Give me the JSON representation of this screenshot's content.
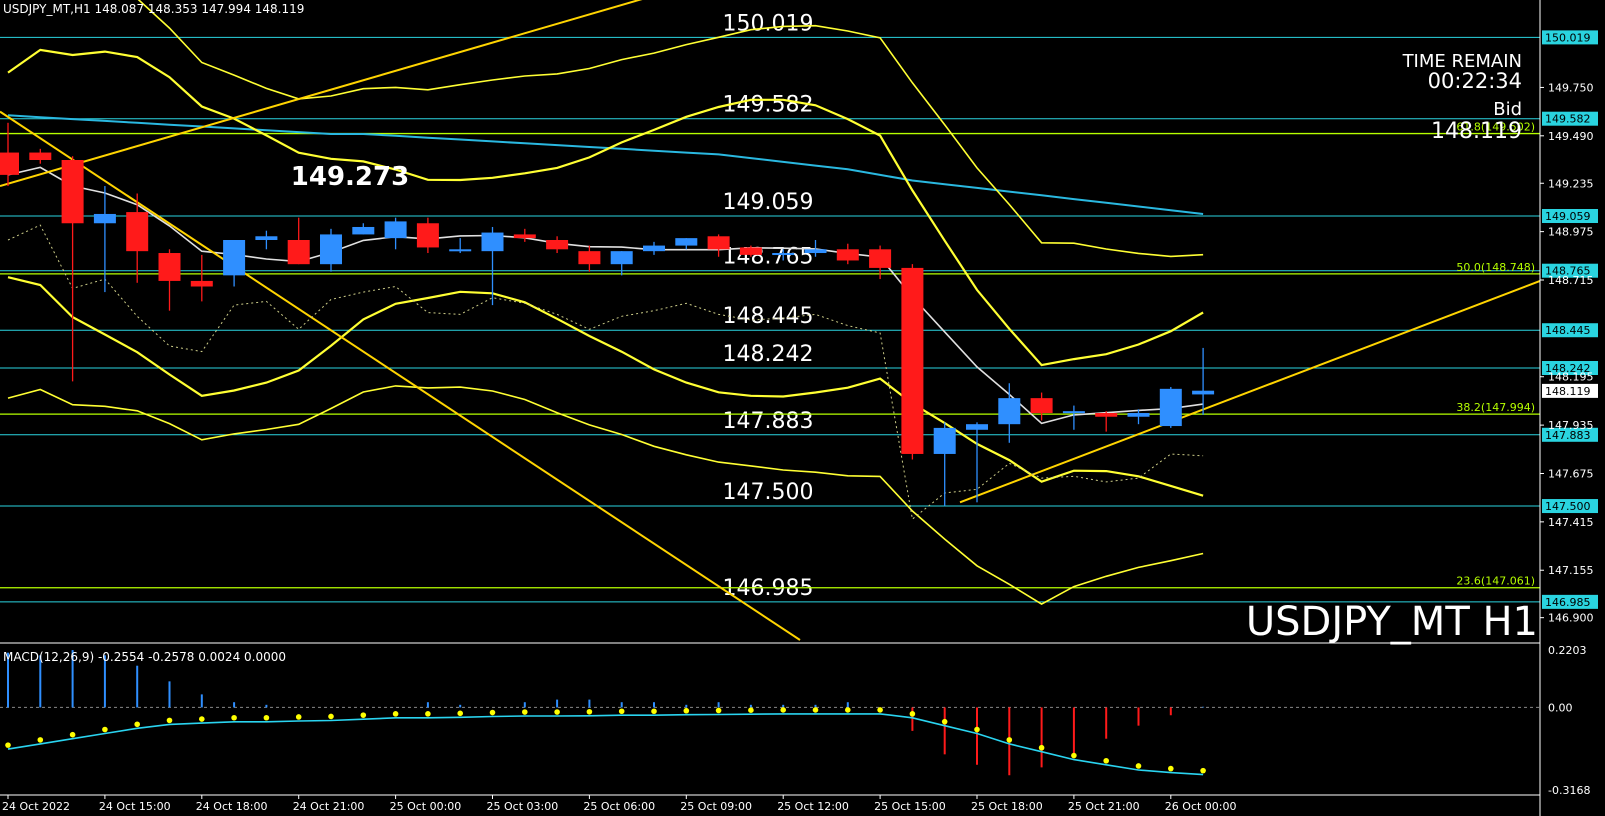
{
  "header": {
    "symbol_line": "USDJPY_MT,H1  148.087 148.353 147.994 148.119"
  },
  "overlay": {
    "time_remain_label": "TIME REMAIN",
    "time_remain_value": "00:22:34",
    "bid_label": "Bid",
    "bid_value": "148.119",
    "watermark": "USDJPY_MT H1"
  },
  "colors": {
    "bg": "#000000",
    "level_line": "#2ad4e0",
    "fib_line": "#b6ff00",
    "bull": "#2f8fff",
    "bear": "#ff1a1a",
    "band": "#ffff33",
    "trend": "#ffd400",
    "ma_white": "#e0e0e0",
    "ma_cyan": "#2ab8e0",
    "macd_signal": "#ffff00",
    "macd_main": "#2ad4f0"
  },
  "chart_data": {
    "type": "candlestick",
    "price_range": [
      146.78,
      150.22
    ],
    "time_axis": [
      "24 Oct 2022",
      "24 Oct 15:00",
      "24 Oct 18:00",
      "24 Oct 21:00",
      "25 Oct 00:00",
      "25 Oct 03:00",
      "25 Oct 06:00",
      "25 Oct 09:00",
      "25 Oct 12:00",
      "25 Oct 15:00",
      "25 Oct 18:00",
      "25 Oct 21:00",
      "26 Oct 00:00"
    ],
    "price_ticks": [
      "149.750",
      "149.490",
      "149.235",
      "148.975",
      "148.715",
      "148.195",
      "147.935",
      "147.675",
      "147.415",
      "147.155",
      "146.900"
    ],
    "level_lines": [
      {
        "value": 150.019,
        "label": "150.019"
      },
      {
        "value": 149.582,
        "label": "149.582"
      },
      {
        "value": 149.059,
        "label": "149.059"
      },
      {
        "value": 148.765,
        "label": "148.765"
      },
      {
        "value": 148.445,
        "label": "148.445"
      },
      {
        "value": 148.242,
        "label": "148.242"
      },
      {
        "value": 147.883,
        "label": "147.883"
      },
      {
        "value": 147.5,
        "label": "147.500"
      },
      {
        "value": 146.985,
        "label": "146.985"
      }
    ],
    "fib_lines": [
      {
        "value": 149.502,
        "label": "61.8(149.502)"
      },
      {
        "value": 148.748,
        "label": "50.0(148.748)"
      },
      {
        "value": 147.994,
        "label": "38.2(147.994)"
      },
      {
        "value": 147.061,
        "label": "23.6(147.061)"
      }
    ],
    "annotation": {
      "text": "149.273",
      "value": 149.273
    },
    "current_price": "148.119",
    "candles": [
      [
        149.4,
        149.56,
        149.22,
        149.28
      ],
      [
        149.4,
        149.42,
        149.34,
        149.36
      ],
      [
        149.36,
        149.38,
        148.17,
        149.02
      ],
      [
        149.02,
        149.22,
        148.65,
        149.07
      ],
      [
        149.08,
        149.18,
        148.7,
        148.87
      ],
      [
        148.86,
        148.88,
        148.55,
        148.71
      ],
      [
        148.71,
        148.85,
        148.6,
        148.68
      ],
      [
        148.74,
        148.93,
        148.68,
        148.93
      ],
      [
        148.93,
        148.98,
        148.88,
        148.95
      ],
      [
        148.93,
        149.05,
        148.8,
        148.8
      ],
      [
        148.8,
        148.99,
        148.76,
        148.96
      ],
      [
        148.96,
        149.02,
        148.96,
        149.0
      ],
      [
        148.94,
        149.05,
        148.88,
        149.03
      ],
      [
        149.02,
        149.05,
        148.86,
        148.89
      ],
      [
        148.88,
        148.94,
        148.86,
        148.88
      ],
      [
        148.87,
        149.0,
        148.58,
        148.97
      ],
      [
        148.96,
        148.99,
        148.92,
        148.94
      ],
      [
        148.93,
        148.95,
        148.86,
        148.88
      ],
      [
        148.87,
        148.9,
        148.76,
        148.8
      ],
      [
        148.8,
        148.87,
        148.74,
        148.87
      ],
      [
        148.87,
        148.92,
        148.85,
        148.9
      ],
      [
        148.9,
        148.94,
        148.88,
        148.94
      ],
      [
        148.95,
        148.96,
        148.84,
        148.88
      ],
      [
        148.89,
        148.9,
        148.84,
        148.85
      ],
      [
        148.85,
        148.88,
        148.82,
        148.86
      ],
      [
        148.86,
        148.93,
        148.84,
        148.88
      ],
      [
        148.88,
        148.91,
        148.8,
        148.82
      ],
      [
        148.88,
        148.9,
        148.72,
        148.78
      ],
      [
        148.78,
        148.8,
        147.75,
        147.78
      ],
      [
        147.78,
        147.95,
        147.5,
        147.92
      ],
      [
        147.91,
        147.95,
        147.52,
        147.94
      ],
      [
        147.94,
        148.16,
        147.84,
        148.08
      ],
      [
        148.08,
        148.11,
        147.96,
        148.0
      ],
      [
        148.0,
        148.04,
        147.91,
        148.01
      ],
      [
        148.0,
        148.01,
        147.9,
        147.98
      ],
      [
        147.98,
        148.02,
        147.94,
        148.0
      ],
      [
        147.93,
        148.14,
        147.92,
        148.13
      ],
      [
        148.1,
        148.35,
        147.99,
        148.12
      ]
    ],
    "macd": {
      "label": "MACD(12,26,9) -0.2554 -0.2578 0.0024 0.0000",
      "range": [
        -0.3168,
        0.2203
      ],
      "ticks": [
        "0.2203",
        "0.00",
        "-0.3168"
      ],
      "histogram": [
        0.21,
        0.2,
        0.22,
        0.2,
        0.16,
        0.1,
        0.05,
        0.02,
        0.01,
        0.0,
        0.0,
        0.0,
        0.0,
        0.02,
        0.01,
        0.0,
        0.02,
        0.03,
        0.03,
        0.02,
        0.02,
        0.01,
        0.02,
        0.01,
        0.01,
        0.01,
        0.02,
        0.0,
        -0.09,
        -0.18,
        -0.22,
        -0.26,
        -0.23,
        -0.18,
        -0.12,
        -0.07,
        -0.03,
        0.0024
      ],
      "signal": [
        -0.16,
        -0.14,
        -0.12,
        -0.1,
        -0.08,
        -0.065,
        -0.06,
        -0.055,
        -0.055,
        -0.052,
        -0.05,
        -0.045,
        -0.04,
        -0.04,
        -0.038,
        -0.035,
        -0.033,
        -0.033,
        -0.032,
        -0.03,
        -0.03,
        -0.028,
        -0.027,
        -0.026,
        -0.025,
        -0.025,
        -0.025,
        -0.025,
        -0.04,
        -0.07,
        -0.1,
        -0.14,
        -0.17,
        -0.2,
        -0.22,
        -0.24,
        -0.25,
        -0.2578
      ]
    }
  }
}
